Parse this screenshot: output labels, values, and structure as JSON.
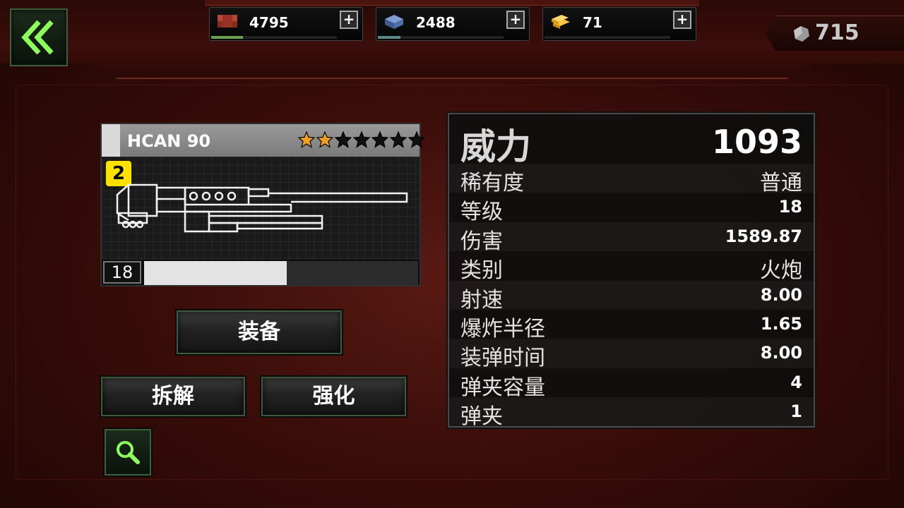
{
  "resources": [
    {
      "name": "bricks",
      "value": "4795",
      "color": "#a2382a",
      "bar_fill": 0.25,
      "bar_color": "#6aa050"
    },
    {
      "name": "steel",
      "value": "2488",
      "color": "#5a7ab0",
      "bar_fill": 0.18,
      "bar_color": "#5a8a88"
    },
    {
      "name": "gold",
      "value": "71",
      "color": "#e3a020",
      "bar_fill": 0,
      "bar_color": "#888"
    }
  ],
  "premium": {
    "value": "715",
    "icon": "gem-icon"
  },
  "weapon": {
    "name": "HCAN 90",
    "stars_filled": 2,
    "stars_total": 7,
    "tier": "2",
    "level": "18",
    "xp_fill": 0.52
  },
  "buttons": {
    "equip": "装备",
    "disassemble": "拆解",
    "upgrade": "强化"
  },
  "stats": {
    "power_label": "威力",
    "power_value": "1093",
    "rows": [
      {
        "label": "稀有度",
        "value": "普通",
        "cjk": true
      },
      {
        "label": "等级",
        "value": "18"
      },
      {
        "label": "伤害",
        "value": "1589.87"
      },
      {
        "label": "类别",
        "value": "火炮",
        "cjk": true
      },
      {
        "label": "射速",
        "value": "8.00"
      },
      {
        "label": "爆炸半径",
        "value": "1.65"
      },
      {
        "label": "装弹时间",
        "value": "8.00"
      },
      {
        "label": "弹夹容量",
        "value": "4"
      },
      {
        "label": "弹夹",
        "value": "1"
      }
    ]
  },
  "colors": {
    "accent_green": "#6be84a",
    "star_filled": "#f0a020",
    "star_empty": "#111111",
    "tier_badge": "#ffe100"
  }
}
